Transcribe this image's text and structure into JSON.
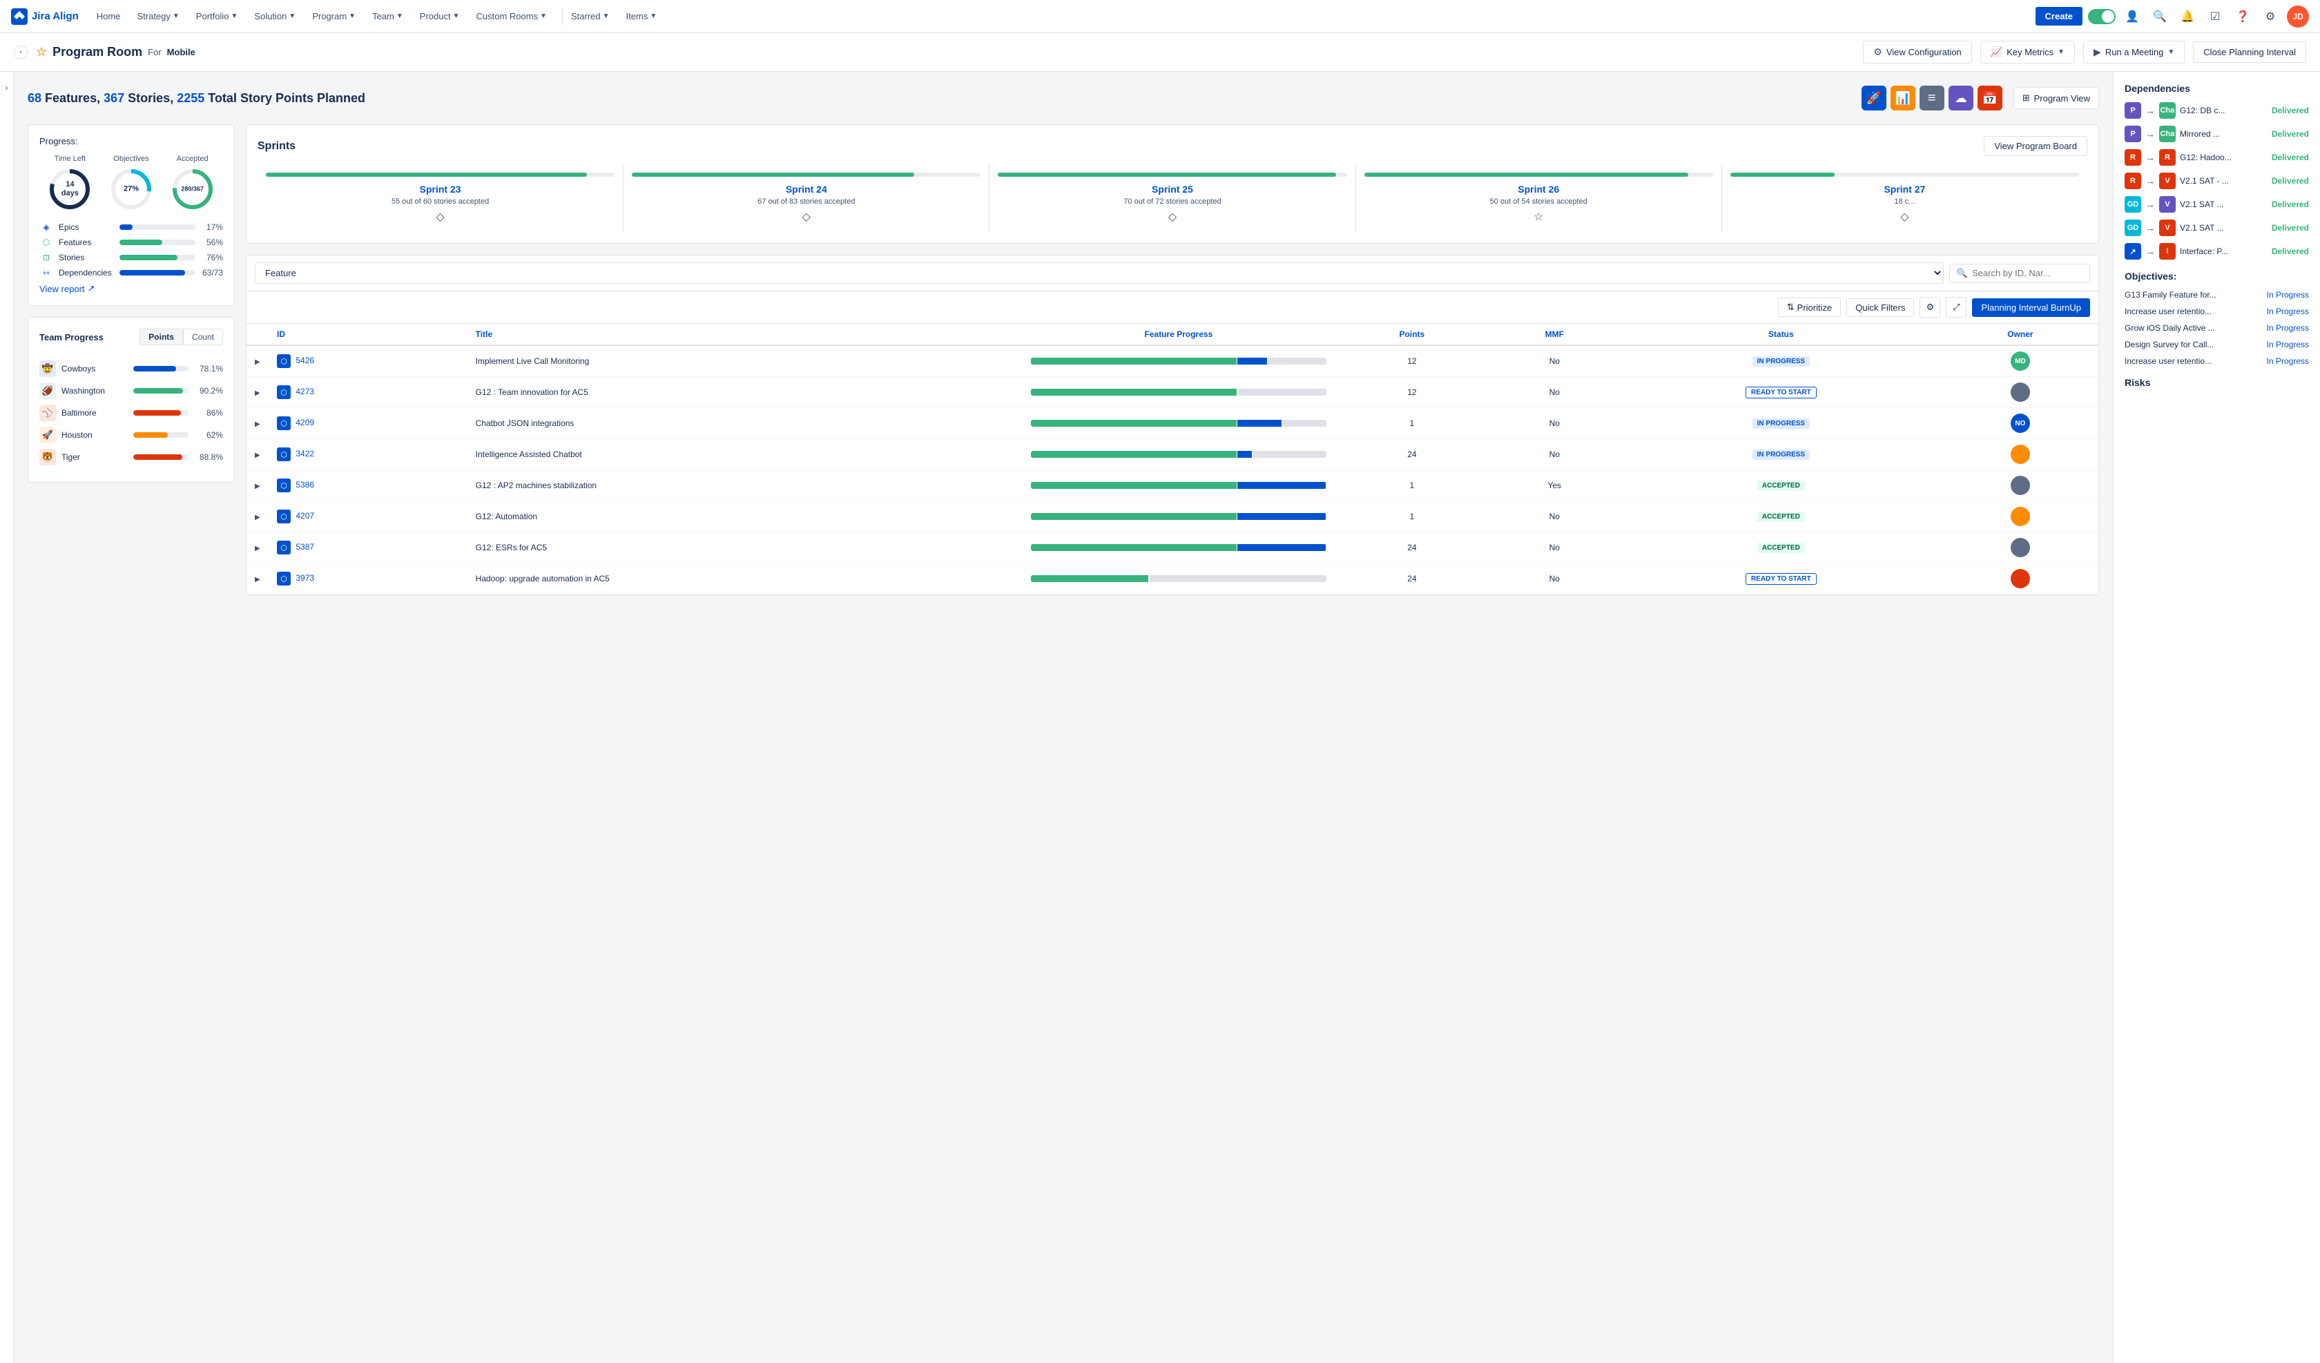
{
  "nav": {
    "logo_text": "Jira Align",
    "items": [
      {
        "label": "Home"
      },
      {
        "label": "Strategy",
        "has_dropdown": true
      },
      {
        "label": "Portfolio",
        "has_dropdown": true
      },
      {
        "label": "Solution",
        "has_dropdown": true
      },
      {
        "label": "Program",
        "has_dropdown": true
      },
      {
        "label": "Team",
        "has_dropdown": true
      },
      {
        "label": "Product",
        "has_dropdown": true
      },
      {
        "label": "Custom Rooms",
        "has_dropdown": true
      },
      {
        "label": "Starred",
        "has_dropdown": true
      },
      {
        "label": "Items",
        "has_dropdown": true
      }
    ],
    "create_btn": "Create"
  },
  "sub_header": {
    "title": "Program Room",
    "for_label": "For",
    "program_name": "Mobile",
    "buttons": {
      "view_config": "View Configuration",
      "key_metrics": "Key Metrics",
      "run_meeting": "Run a Meeting",
      "close_interval": "Close Planning Interval"
    }
  },
  "summary": {
    "features_count": "68",
    "stories_count": "367",
    "points_total": "2255",
    "text": "Features,",
    "text2": "Stories,",
    "text3": "Total Story Points Planned"
  },
  "view_icons": [
    {
      "name": "rocket-icon",
      "symbol": "🚀",
      "color": "#0052cc"
    },
    {
      "name": "chart-icon",
      "symbol": "📊",
      "color": "#ff8b00"
    },
    {
      "name": "list-icon",
      "symbol": "≡",
      "color": "#5e6c84"
    },
    {
      "name": "cloud-icon",
      "symbol": "☁",
      "color": "#6554c0"
    },
    {
      "name": "calendar-icon",
      "symbol": "📅",
      "color": "#de350b"
    }
  ],
  "program_view_label": "Program View",
  "progress": {
    "label": "Progress:",
    "circles": [
      {
        "label": "Time Left",
        "value": "14 days",
        "pct": 80,
        "color": "#172b4d",
        "track": "#ebecf0"
      },
      {
        "label": "Objectives",
        "value": "27%",
        "pct": 27,
        "color": "#00b8d9",
        "track": "#ebecf0"
      },
      {
        "label": "Accepted",
        "value": "280/367",
        "pct": 76,
        "color": "#36b37e",
        "track": "#ebecf0"
      }
    ],
    "bars": [
      {
        "label": "Epics",
        "pct": 17,
        "color": "#0052cc"
      },
      {
        "label": "Features",
        "pct": 56,
        "color": "#36b37e"
      },
      {
        "label": "Stories",
        "pct": 76,
        "color": "#36b37e"
      },
      {
        "label": "Dependencies",
        "pct": 86,
        "color": "#0052cc",
        "extra": "63/73"
      }
    ],
    "view_report": "View report"
  },
  "team_progress": {
    "title": "Team Progress",
    "tabs": [
      "Points",
      "Count"
    ],
    "active_tab": 0,
    "teams": [
      {
        "name": "Cowboys",
        "pct": 78.1,
        "color": "#0052cc"
      },
      {
        "name": "Washington",
        "pct": 90.2,
        "color": "#36b37e"
      },
      {
        "name": "Baltimore",
        "pct": 86,
        "color": "#de350b"
      },
      {
        "name": "Houston",
        "pct": 62,
        "color": "#ff8b00"
      },
      {
        "name": "Tiger",
        "pct": 88.8,
        "color": "#de350b"
      }
    ]
  },
  "sprints": {
    "title": "Sprints",
    "view_board_btn": "View Program Board",
    "items": [
      {
        "name": "Sprint 23",
        "accepted": "55 out of 60 stories accepted",
        "pct": 92
      },
      {
        "name": "Sprint 24",
        "accepted": "67 out of 83 stories accepted",
        "pct": 81
      },
      {
        "name": "Sprint 25",
        "accepted": "70 out of 72 stories accepted",
        "pct": 97
      },
      {
        "name": "Sprint 26",
        "accepted": "50 out of 54 stories accepted",
        "pct": 93
      },
      {
        "name": "Sprint 27",
        "accepted": "18 c...",
        "pct": 30
      }
    ]
  },
  "feature_table": {
    "filter_label": "Feature",
    "search_placeholder": "Search by ID, Nar...",
    "toolbar_btns": [
      "Prioritize",
      "Quick Filters",
      "Planning Interval BurnUp"
    ],
    "columns": [
      "ID",
      "Title",
      "Feature Progress",
      "Points",
      "MMF",
      "Status",
      "Owner"
    ],
    "rows": [
      {
        "id": "5426",
        "title": "Implement Live Call Monitoring",
        "points": "12",
        "mmf": "No",
        "status": "IN PROGRESS",
        "status_type": "in_progress",
        "progress": 80,
        "owner_initials": "MD",
        "owner_color": "#36b37e"
      },
      {
        "id": "4273",
        "title": "G12 : Team innovation for AC5",
        "points": "12",
        "mmf": "No",
        "status": "READY TO START",
        "status_type": "ready_start",
        "progress": 70,
        "owner_initials": "",
        "owner_color": "#5e6c84"
      },
      {
        "id": "4209",
        "title": "Chatbot JSON integrations",
        "points": "1",
        "mmf": "No",
        "status": "IN PROGRESS",
        "status_type": "in_progress",
        "progress": 85,
        "owner_initials": "NO",
        "owner_color": "#0052cc"
      },
      {
        "id": "3422",
        "title": "Intelligence Assisted Chatbot",
        "points": "24",
        "mmf": "No",
        "status": "IN PROGRESS",
        "status_type": "in_progress",
        "progress": 75,
        "owner_initials": "",
        "owner_color": "#ff8b00"
      },
      {
        "id": "5386",
        "title": "G12 : AP2 machines stabilization",
        "points": "1",
        "mmf": "Yes",
        "status": "ACCEPTED",
        "status_type": "accepted",
        "progress": 100,
        "owner_initials": "",
        "owner_color": "#5e6c84"
      },
      {
        "id": "4207",
        "title": "G12: Automation",
        "points": "1",
        "mmf": "No",
        "status": "ACCEPTED",
        "status_type": "accepted",
        "progress": 100,
        "owner_initials": "",
        "owner_color": "#ff8b00"
      },
      {
        "id": "5387",
        "title": "G12: ESRs for AC5",
        "points": "24",
        "mmf": "No",
        "status": "ACCEPTED",
        "status_type": "accepted",
        "progress": 100,
        "owner_initials": "",
        "owner_color": "#5e6c84"
      },
      {
        "id": "3973",
        "title": "Hadoop: upgrade automation in AC5",
        "points": "24",
        "mmf": "No",
        "status": "READY TO START",
        "status_type": "ready_start",
        "progress": 40,
        "owner_initials": "",
        "owner_color": "#de350b"
      }
    ]
  },
  "right_sidebar": {
    "dependencies_title": "Dependencies",
    "dependencies": [
      {
        "from_color": "#6554c0",
        "from_label": "P",
        "to_color": "#36b37e",
        "to_label": "Cha",
        "name": "G12: DB c...",
        "status": "Delivered"
      },
      {
        "from_color": "#6554c0",
        "from_label": "P",
        "to_color": "#36b37e",
        "to_label": "Cha",
        "name": "Mirrored ...",
        "status": "Delivered"
      },
      {
        "from_color": "#de350b",
        "from_label": "R",
        "to_color": "#de350b",
        "to_label": "R",
        "name": "G12: Hadoo...",
        "status": "Delivered"
      },
      {
        "from_color": "#de350b",
        "from_label": "R",
        "to_color": "#de350b",
        "to_label": "V",
        "name": "V2.1 SAT - ...",
        "status": "Delivered"
      },
      {
        "from_color": "#00b8d9",
        "from_label": "GD",
        "to_color": "#6554c0",
        "to_label": "V",
        "name": "V2.1 SAT ...",
        "status": "Delivered"
      },
      {
        "from_color": "#00b8d9",
        "from_label": "GD",
        "to_color": "#de350b",
        "to_label": "V",
        "name": "V2.1 SAT ...",
        "status": "Delivered"
      },
      {
        "from_color": "#0052cc",
        "from_label": "↗",
        "to_color": "#de350b",
        "to_label": "I",
        "name": "Interface: P...",
        "status": "Delivered"
      }
    ],
    "objectives_title": "Objectives:",
    "objectives": [
      {
        "name": "G13 Family Feature for...",
        "status": "In Progress"
      },
      {
        "name": "Increase user retentio...",
        "status": "In Progress"
      },
      {
        "name": "Grow iOS Daily Active ...",
        "status": "In Progress"
      },
      {
        "name": "Design Survey for Call...",
        "status": "In Progress"
      },
      {
        "name": "Increase user retentio...",
        "status": "In Progress"
      }
    ],
    "risks_title": "Risks"
  }
}
